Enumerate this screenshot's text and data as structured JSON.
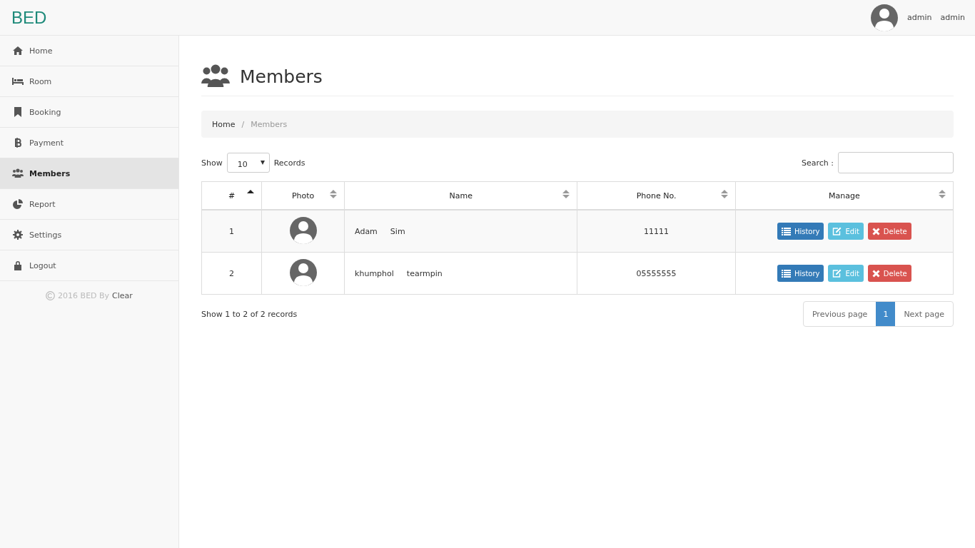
{
  "header": {
    "logo": "BED",
    "user_first": "admin",
    "user_last": "admin"
  },
  "sidebar": {
    "items": [
      {
        "label": "Home",
        "selected": false
      },
      {
        "label": "Room",
        "selected": false
      },
      {
        "label": "Booking",
        "selected": false
      },
      {
        "label": "Payment",
        "selected": false
      },
      {
        "label": "Members",
        "selected": true
      },
      {
        "label": "Report",
        "selected": false
      },
      {
        "label": "Settings",
        "selected": false
      },
      {
        "label": "Logout",
        "selected": false
      }
    ],
    "footer": {
      "year": "2016 BED By",
      "author": "Clear"
    }
  },
  "page": {
    "title": "Members"
  },
  "breadcrumb": {
    "separator": "/",
    "items": [
      {
        "label": "Home",
        "selected": false
      },
      {
        "label": "Members",
        "selected": true
      }
    ]
  },
  "length": {
    "show": "Show",
    "value": "10",
    "records": "Records"
  },
  "search": {
    "label": "Search :"
  },
  "table": {
    "columns": [
      {
        "label": "#",
        "sorted": true
      },
      {
        "label": "Photo",
        "sorted": false
      },
      {
        "label": "Name",
        "sorted": false
      },
      {
        "label": "Phone No.",
        "sorted": false
      },
      {
        "label": "Manage",
        "sorted": false
      }
    ],
    "rows": [
      {
        "index": "1",
        "first_name": "Adam",
        "last_name": "Sim",
        "phone": "11111",
        "actions": [
          {
            "kind": "history",
            "label": "History"
          },
          {
            "kind": "edit",
            "label": "Edit"
          },
          {
            "kind": "delete",
            "label": "Delete"
          }
        ]
      },
      {
        "index": "2",
        "first_name": "khumphol",
        "last_name": "tearmpin",
        "phone": "05555555",
        "actions": [
          {
            "kind": "history",
            "label": "History"
          },
          {
            "kind": "edit",
            "label": "Edit"
          },
          {
            "kind": "delete",
            "label": "Delete"
          }
        ]
      }
    ]
  },
  "info": "Show 1 to 2 of 2 records",
  "pagination": {
    "previous": "Previous page",
    "pages": [
      {
        "label": "1",
        "selected": true
      }
    ],
    "next": "Next page"
  }
}
